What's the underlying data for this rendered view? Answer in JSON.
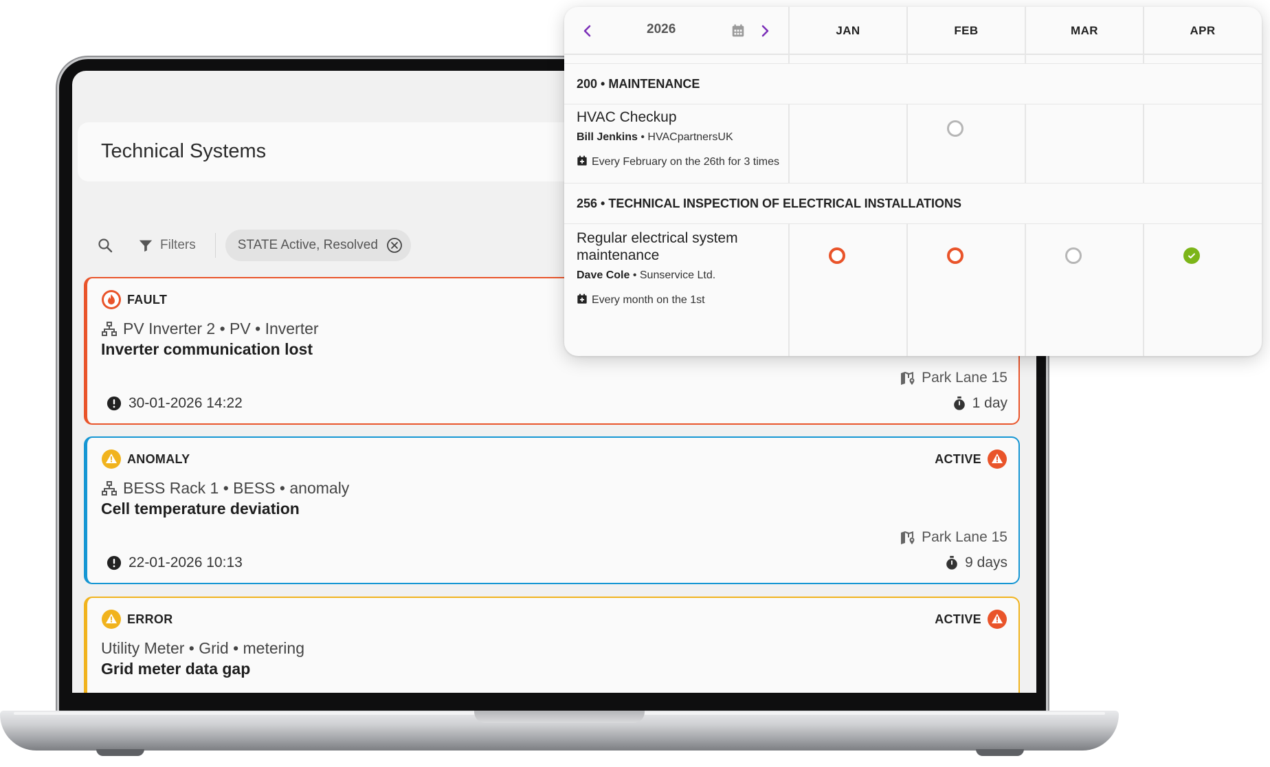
{
  "app": {
    "page_title": "Technical Systems"
  },
  "toolbar": {
    "filters_label": "Filters",
    "chip_label": "STATE Active, Resolved"
  },
  "cards": [
    {
      "type": "FAULT",
      "state": "",
      "path": "PV Inverter 2 • PV • Inverter",
      "title": "Inverter communication lost",
      "location": "Park Lane 15",
      "duration": "1 day",
      "date": "30-01-2026 14:22",
      "accent": "#e9542a"
    },
    {
      "type": "ANOMALY",
      "state": "ACTIVE",
      "path": "BESS Rack 1 • BESS • anomaly",
      "title": "Cell temperature deviation",
      "location": "Park Lane 15",
      "duration": "9 days",
      "date": "22-01-2026 10:13",
      "accent": "#1596d3"
    },
    {
      "type": "ERROR",
      "state": "ACTIVE",
      "path": "Utility Meter • Grid • metering",
      "title": "Grid meter data gap",
      "accent": "#f1b31d"
    }
  ],
  "calendar": {
    "year": "2026",
    "months": [
      "JAN",
      "FEB",
      "MAR",
      "APR"
    ],
    "groups": [
      {
        "label": "200 • MAINTENANCE",
        "task": {
          "name": "HVAC Checkup",
          "person": "Bill Jenkins",
          "company": "HVACpartnersUK",
          "recurrence": "Every February on the 26th for 3 times",
          "marks": [
            "",
            "scheduled",
            "",
            ""
          ]
        }
      },
      {
        "label": "256 • TECHNICAL INSPECTION OF ELECTRICAL INSTALLATIONS",
        "task": {
          "name": "Regular electrical system maintenance",
          "person": "Dave Cole",
          "company": "Sunservice Ltd.",
          "recurrence": "Every month on the 1st",
          "marks": [
            "overdue",
            "overdue",
            "scheduled",
            "done"
          ]
        }
      }
    ],
    "colors": {
      "nav_arrow": "#7b2fb8",
      "overdue": "#e9542a",
      "scheduled": "#b6b6b6",
      "done": "#7cb518"
    }
  }
}
